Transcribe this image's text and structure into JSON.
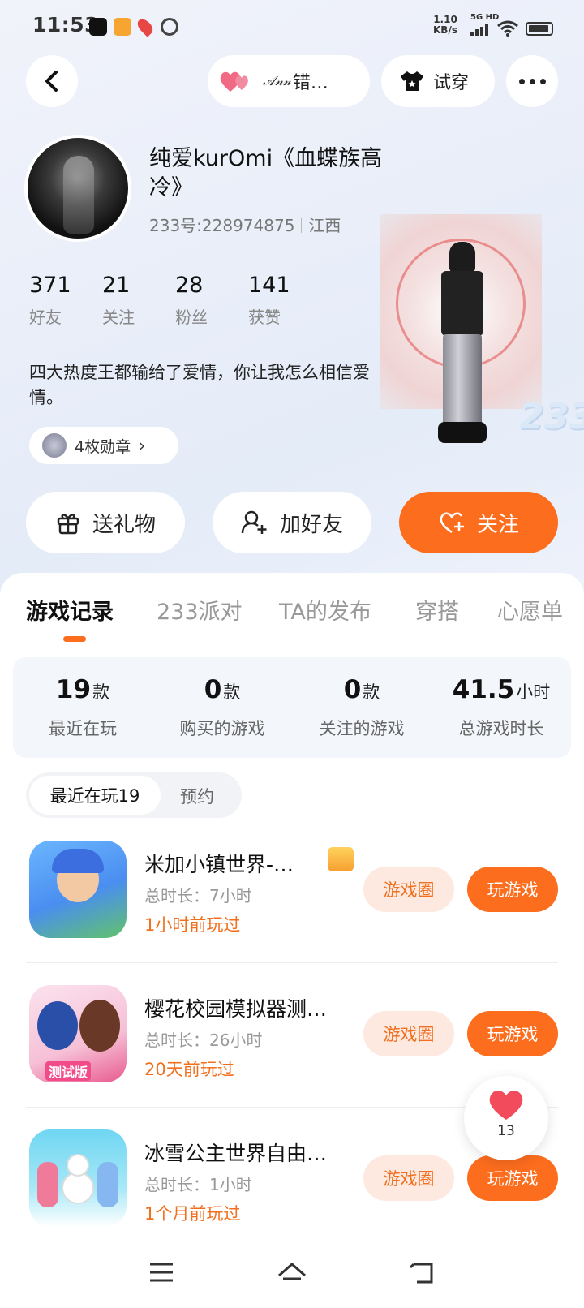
{
  "status_bar": {
    "time": "11:53",
    "net_speed": "1.10",
    "net_unit": "KB/s",
    "signal_label": "5G HD"
  },
  "header": {
    "liked_name": "𝒜𝓃𝓃",
    "liked_suffix": "错…",
    "try_on_label": "试穿"
  },
  "profile": {
    "name": "纯爱kurOmi《血蝶族高冷》",
    "uid": "233号:228974875",
    "location": "江西",
    "stats": [
      {
        "num": "371",
        "label": "好友"
      },
      {
        "num": "21",
        "label": "关注"
      },
      {
        "num": "28",
        "label": "粉丝"
      },
      {
        "num": "141",
        "label": "获赞"
      }
    ],
    "bio": "四大热度王都输给了爱情，你让我怎么相信爱情。",
    "badges": "4枚勋章"
  },
  "actions": {
    "gift": "送礼物",
    "add_friend": "加好友",
    "follow": "关注"
  },
  "tabs": [
    "游戏记录",
    "233派对",
    "TA的发布",
    "穿搭",
    "心愿单"
  ],
  "summary": [
    {
      "value": "19",
      "unit": "款",
      "label": "最近在玩"
    },
    {
      "value": "0",
      "unit": "款",
      "label": "购买的游戏"
    },
    {
      "value": "0",
      "unit": "款",
      "label": "关注的游戏"
    },
    {
      "value": "41.5",
      "unit": "小时",
      "label": "总游戏时长"
    }
  ],
  "segment": {
    "recent": "最近在玩19",
    "reserve": "预约"
  },
  "games": [
    {
      "title": "米加小镇世界-…",
      "duration": "总时长：7小时",
      "played": "1小时前玩过"
    },
    {
      "title": "樱花校园模拟器测…",
      "duration": "总时长：26小时",
      "played": "20天前玩过"
    },
    {
      "title": "冰雪公主世界自由…",
      "duration": "总时长：1小时",
      "played": "1个月前玩过"
    }
  ],
  "game_buttons": {
    "circle": "游戏圈",
    "play": "玩游戏"
  },
  "float_like_count": "13",
  "colors": {
    "accent": "#fd6d1e",
    "accent_light": "#fde9df",
    "heart": "#f24b5b"
  }
}
